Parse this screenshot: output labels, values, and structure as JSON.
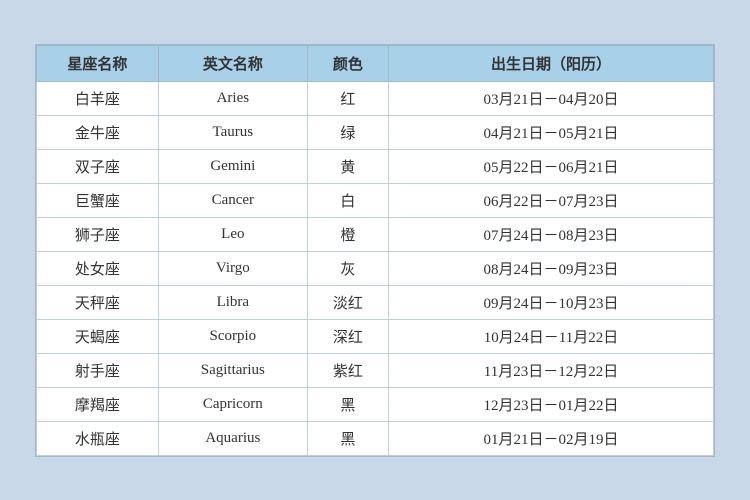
{
  "table": {
    "headers": {
      "zh_name": "星座名称",
      "en_name": "英文名称",
      "color": "颜色",
      "date": "出生日期（阳历）"
    },
    "rows": [
      {
        "zh": "白羊座",
        "en": "Aries",
        "color": "红",
        "date": "03月21日－04月20日"
      },
      {
        "zh": "金牛座",
        "en": "Taurus",
        "color": "绿",
        "date": "04月21日－05月21日"
      },
      {
        "zh": "双子座",
        "en": "Gemini",
        "color": "黄",
        "date": "05月22日－06月21日"
      },
      {
        "zh": "巨蟹座",
        "en": "Cancer",
        "color": "白",
        "date": "06月22日－07月23日"
      },
      {
        "zh": "狮子座",
        "en": "Leo",
        "color": "橙",
        "date": "07月24日－08月23日"
      },
      {
        "zh": "处女座",
        "en": "Virgo",
        "color": "灰",
        "date": "08月24日－09月23日"
      },
      {
        "zh": "天秤座",
        "en": "Libra",
        "color": "淡红",
        "date": "09月24日－10月23日"
      },
      {
        "zh": "天蝎座",
        "en": "Scorpio",
        "color": "深红",
        "date": "10月24日－11月22日"
      },
      {
        "zh": "射手座",
        "en": "Sagittarius",
        "color": "紫红",
        "date": "11月23日－12月22日"
      },
      {
        "zh": "摩羯座",
        "en": "Capricorn",
        "color": "黑",
        "date": "12月23日－01月22日"
      },
      {
        "zh": "水瓶座",
        "en": "Aquarius",
        "color": "黑",
        "date": "01月21日－02月19日"
      }
    ]
  }
}
